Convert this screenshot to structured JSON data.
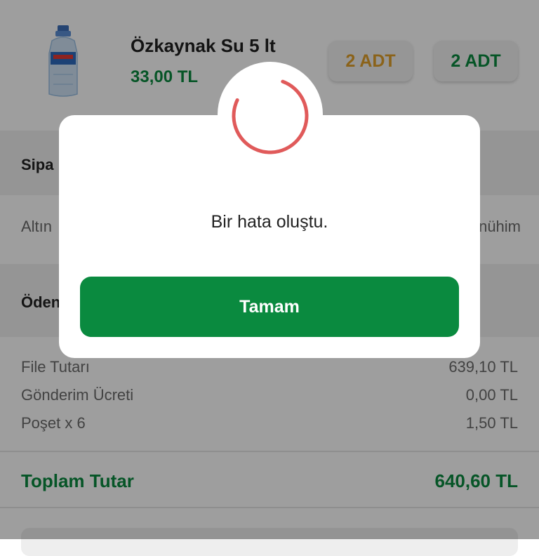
{
  "product": {
    "name": "Özkaynak Su 5 lt",
    "price": "33,00 TL",
    "qty_buttons": [
      "2 ADT",
      "2 ADT"
    ]
  },
  "sections": {
    "order_title_partial": "Sipa",
    "delivery_left_partial": "Altın",
    "delivery_right_partial": "nühim",
    "payment_title_partial": "Öden"
  },
  "summary": {
    "lines": [
      {
        "label": "File Tutarı",
        "value": "639,10 TL"
      },
      {
        "label": "Gönderim Ücreti",
        "value": "0,00 TL"
      },
      {
        "label": "Poşet x 6",
        "value": "1,50 TL"
      }
    ],
    "total_label": "Toplam Tutar",
    "total_value": "640,60 TL"
  },
  "modal": {
    "message": "Bir hata oluştu.",
    "button_label": "Tamam",
    "icon": "loading-spinner-icon"
  },
  "colors": {
    "brand_green": "#0a8a3f",
    "accent_orange": "#e0a02a",
    "spinner_red": "#e05a5a"
  }
}
